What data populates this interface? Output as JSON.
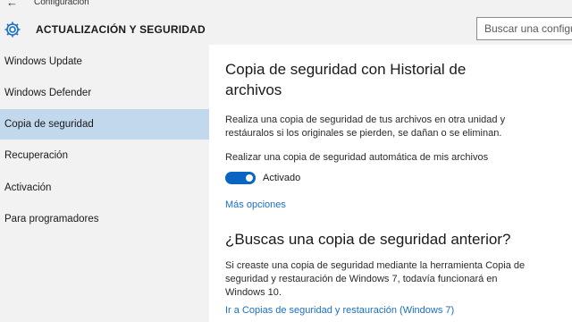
{
  "window": {
    "title": "Configuración"
  },
  "header": {
    "title": "ACTUALIZACIÓN Y SEGURIDAD",
    "search_placeholder": "Buscar una configuración"
  },
  "sidebar": {
    "items": [
      {
        "label": "Windows Update",
        "active": false
      },
      {
        "label": "Windows Defender",
        "active": false
      },
      {
        "label": "Copia de seguridad",
        "active": true
      },
      {
        "label": "Recuperación",
        "active": false
      },
      {
        "label": "Activación",
        "active": false
      },
      {
        "label": "Para programadores",
        "active": false
      }
    ]
  },
  "main": {
    "heading": "Copia de seguridad con Historial de archivos",
    "description": "Realiza una copia de seguridad de tus archivos en otra unidad y restáuralos si los originales se pierden, se dañan o se eliminan.",
    "auto_backup_label": "Realizar una copia de seguridad automática de mis archivos",
    "toggle_state": "Activado",
    "toggle_on": true,
    "more_options": "Más opciones",
    "old_backup_heading": "¿Buscas una copia de seguridad anterior?",
    "old_backup_text": "Si creaste una copia de seguridad mediante la herramienta Copia de seguridad y restauración de Windows 7, todavía funcionará en Windows 10.",
    "restore_link": "Ir a Copias de seguridad y restauración (Windows 7)"
  },
  "colors": {
    "accent": "#0a64c2",
    "link": "#1a6fc4",
    "selected": "#c2d8ec",
    "panel": "#f2f2f2"
  },
  "icons": {
    "back": "back-arrow-icon",
    "settings": "gear-icon"
  }
}
